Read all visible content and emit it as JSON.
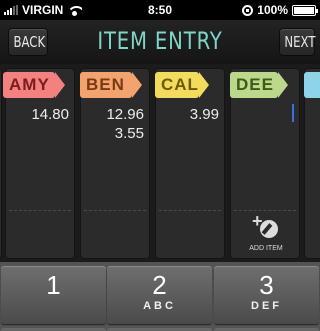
{
  "status_bar": {
    "carrier": "VIRGIN",
    "time": "8:50",
    "battery": "100%"
  },
  "nav": {
    "title": "ITEM ENTRY",
    "back_label": "BACK",
    "next_label": "NEXT"
  },
  "people": [
    {
      "name": "AMY",
      "color": "#f28180",
      "amounts": [
        "14.80"
      ]
    },
    {
      "name": "BEN",
      "color": "#f3a36d",
      "amounts": [
        "12.96",
        "3.55"
      ]
    },
    {
      "name": "CAL",
      "color": "#f3dc5d",
      "amounts": [
        "3.99"
      ]
    },
    {
      "name": "DEE",
      "color": "#bcd98b",
      "amounts": [],
      "add_item_label": "ADD ITEM"
    }
  ],
  "keypad": [
    {
      "number": "1",
      "letters": ""
    },
    {
      "number": "2",
      "letters": "ABC"
    },
    {
      "number": "3",
      "letters": "DEF"
    }
  ]
}
